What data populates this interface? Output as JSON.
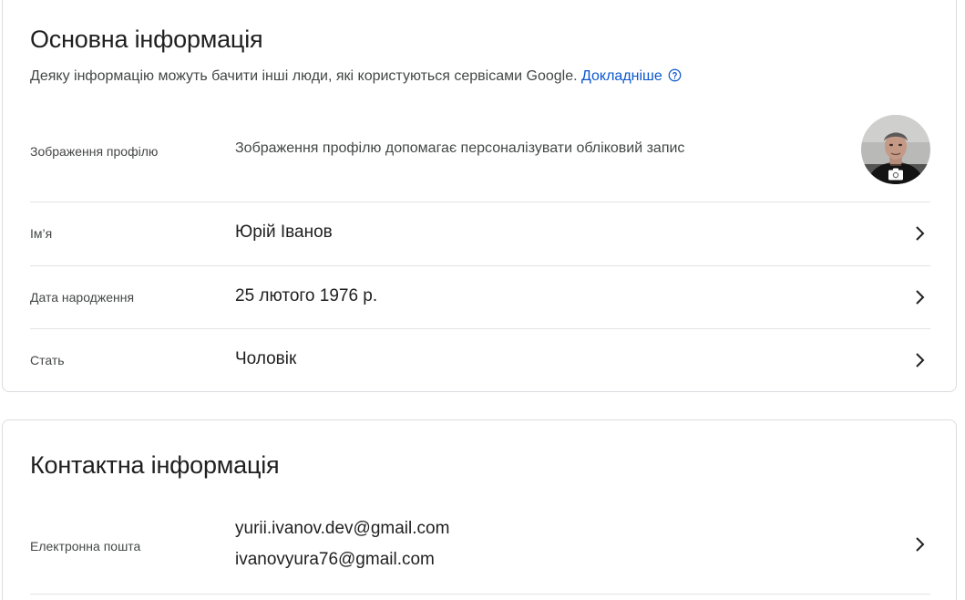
{
  "basic": {
    "title": "Основна інформація",
    "subtitle": "Деяку інформацію можуть бачити інші люди, які користуються сервісами Google.",
    "more_link": "Докладніше",
    "help_icon": "help-circle-icon",
    "profile_picture": {
      "label": "Зображення профілю",
      "description": "Зображення профілю допомагає персоналізувати обліковий запис",
      "camera_icon": "camera-icon"
    },
    "name": {
      "label": "Ім’я",
      "value": "Юрій Іванов"
    },
    "birthday": {
      "label": "Дата народження",
      "value": "25 лютого 1976 р."
    },
    "gender": {
      "label": "Стать",
      "value": "Чоловік"
    }
  },
  "contact": {
    "title": "Контактна інформація",
    "email": {
      "label": "Електронна пошта",
      "values": [
        "yurii.ivanov.dev@gmail.com",
        "ivanovyura76@gmail.com"
      ]
    }
  },
  "colors": {
    "link": "#0b57d0",
    "text_primary": "#1f1f1f",
    "text_secondary": "#444746",
    "divider": "#e3e3e3",
    "card_border": "#dadce0"
  },
  "icons": {
    "chevron": "chevron-right-icon"
  }
}
